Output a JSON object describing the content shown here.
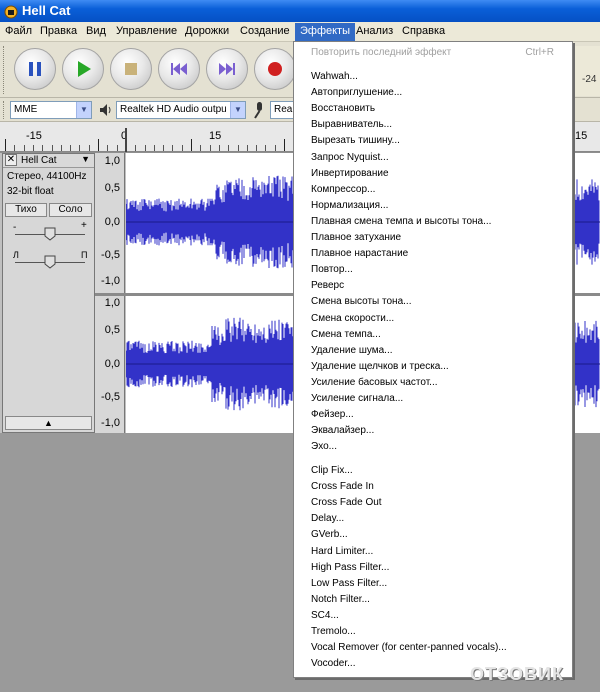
{
  "window": {
    "title": "Hell Cat"
  },
  "menubar": {
    "items": [
      "Файл",
      "Правка",
      "Вид",
      "Управление",
      "Дорожки",
      "Создание",
      "Эффекты",
      "Анализ",
      "Справка"
    ]
  },
  "toolbar": {
    "buttons": [
      "pause",
      "play",
      "stop",
      "skip-start",
      "skip-end",
      "record"
    ],
    "meter_value": "-24"
  },
  "devicebar": {
    "host": "MME",
    "output": "Realtek HD Audio outpu",
    "input": "Rea"
  },
  "ruler": {
    "ticks": [
      "-15",
      "0",
      "15",
      "15"
    ]
  },
  "track": {
    "name": "Hell Cat",
    "format": "Стерео, 44100Hz",
    "bitdepth": "32-bit float",
    "mute_label": "Тихо",
    "solo_label": "Соло",
    "gain_minus": "-",
    "gain_plus": "+",
    "pan_left": "Л",
    "pan_right": "П",
    "scale_top": [
      "1,0",
      "0,5",
      "0,0",
      "-0,5",
      "-1,0"
    ],
    "scale_bottom": [
      "1,0",
      "0,5",
      "0,0",
      "-0,5",
      "-1,0"
    ],
    "collapse_icon": "▲"
  },
  "effects_menu": {
    "repeat_last": "Повторить последний эффект",
    "repeat_shortcut": "Ctrl+R",
    "builtin": [
      "Wahwah...",
      "Автоприглушение...",
      "Восстановить",
      "Выравниватель...",
      "Вырезать тишину...",
      "Запрос Nyquist...",
      "Инвертирование",
      "Компрессор...",
      "Нормализация...",
      "Плавная смена темпа и высоты тона...",
      "Плавное затухание",
      "Плавное нарастание",
      "Повтор...",
      "Реверс",
      "Смена высоты тона...",
      "Смена скорости...",
      "Смена темпа...",
      "Удаление шума...",
      "Удаление щелчков и треска...",
      "Усиление басовых частот...",
      "Усиление сигнала...",
      "Фейзер...",
      "Эквалайзер...",
      "Эхо..."
    ],
    "plugins": [
      "Clip Fix...",
      "Cross Fade In",
      "Cross Fade Out",
      "Delay...",
      "GVerb...",
      "Hard Limiter...",
      "High Pass Filter...",
      "Low Pass Filter...",
      "Notch Filter...",
      "SC4...",
      "Tremolo...",
      "Vocal Remover (for center-panned vocals)...",
      "Vocoder..."
    ]
  },
  "watermark": "ОТЗОВИК",
  "colors": {
    "waveform": "#3232c8",
    "menu_highlight": "#316ac5",
    "titlebar": "#0a5fd8"
  }
}
